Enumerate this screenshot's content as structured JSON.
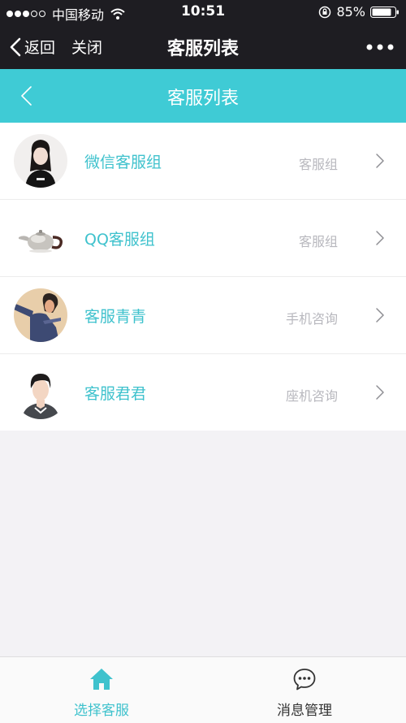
{
  "status_bar": {
    "carrier": "中国移动",
    "time": "10:51",
    "battery": "85%"
  },
  "wechat_nav": {
    "back_label": "返回",
    "close_label": "关闭",
    "title": "客服列表"
  },
  "header": {
    "title": "客服列表"
  },
  "agents": [
    {
      "name": "微信客服组",
      "type": "客服组",
      "avatar": "girl-photo"
    },
    {
      "name": "QQ客服组",
      "type": "客服组",
      "avatar": "teapot-photo"
    },
    {
      "name": "客服青青",
      "type": "手机咨询",
      "avatar": "woman-illustration"
    },
    {
      "name": "客服君君",
      "type": "座机咨询",
      "avatar": "boy-photo"
    }
  ],
  "tabs": [
    {
      "label": "选择客服",
      "icon": "home-icon",
      "active": true
    },
    {
      "label": "消息管理",
      "icon": "chat-bubble-icon",
      "active": false
    }
  ],
  "colors": {
    "accent": "#3fcbd5",
    "accent_text": "#3fc2cd",
    "nav_bg": "#1e1d22",
    "page_bg": "#f3f2f5"
  }
}
